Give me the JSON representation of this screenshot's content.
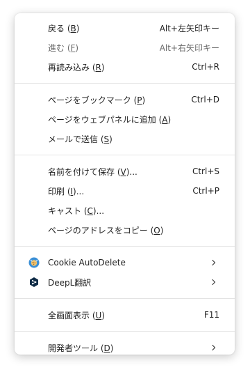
{
  "menu": {
    "groups": [
      {
        "items": [
          {
            "pre": "戻る (",
            "key": "B",
            "post": ")",
            "shortcut": "Alt+左矢印キー",
            "disabled": false
          },
          {
            "pre": "進む (",
            "key": "F",
            "post": ")",
            "shortcut": "Alt+右矢印キー",
            "disabled": true
          },
          {
            "pre": "再読み込み (",
            "key": "R",
            "post": ")",
            "shortcut": "Ctrl+R",
            "disabled": false
          }
        ]
      },
      {
        "items": [
          {
            "pre": "ページをブックマーク (",
            "key": "P",
            "post": ")",
            "shortcut": "Ctrl+D"
          },
          {
            "pre": "ページをウェブパネルに追加 (",
            "key": "A",
            "post": ")",
            "shortcut": ""
          },
          {
            "pre": "メールで送信 (",
            "key": "S",
            "post": ")",
            "shortcut": ""
          }
        ]
      },
      {
        "items": [
          {
            "pre": "名前を付けて保存 (",
            "key": "V",
            "post": ")...",
            "shortcut": "Ctrl+S"
          },
          {
            "pre": "印刷 (",
            "key": "I",
            "post": ")...",
            "shortcut": "Ctrl+P"
          },
          {
            "pre": "キャスト (",
            "key": "C",
            "post": ")...",
            "shortcut": ""
          },
          {
            "pre": "ページのアドレスをコピー (",
            "key": "O",
            "post": ")",
            "shortcut": ""
          }
        ]
      },
      {
        "items": [
          {
            "label": "Cookie AutoDelete",
            "icon": "cookie-autodelete-icon",
            "submenu": true
          },
          {
            "label": "DeepL翻訳",
            "icon": "deepl-icon",
            "submenu": true
          }
        ]
      },
      {
        "items": [
          {
            "pre": "全画面表示 (",
            "key": "U",
            "post": ")",
            "shortcut": "F11"
          }
        ]
      },
      {
        "items": [
          {
            "pre": "開発者ツール (",
            "key": "D",
            "post": ")",
            "submenu": true
          }
        ]
      }
    ]
  },
  "colors": {
    "text": "#1f1f1f",
    "disabled": "#6b6b6b",
    "separator": "#e3e3e3",
    "cookie_icon": "#3b8fd6",
    "deepl_icon": "#0f2b46"
  }
}
